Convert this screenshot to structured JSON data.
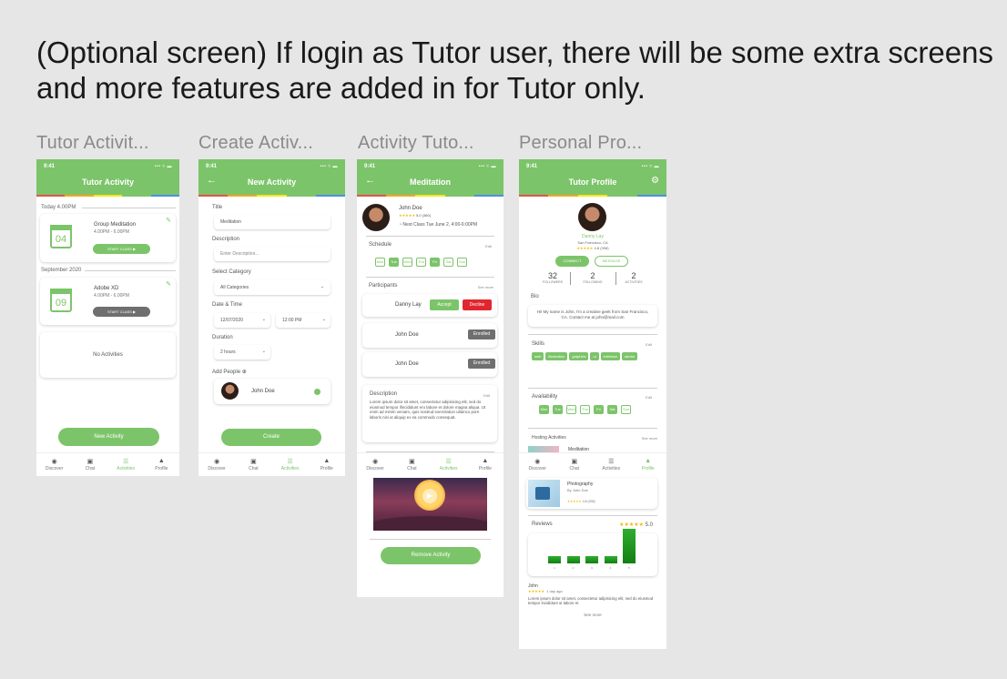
{
  "headline": "(Optional screen) If login as Tutor user, there will be some extra screens and more features are added in for Tutor only.",
  "colors": {
    "accent": "#7cc46a",
    "stripe": [
      "#e2544a",
      "#f5a623",
      "#f8e71c",
      "#7cc46a",
      "#4a90e2"
    ]
  },
  "status": {
    "time": "9:41",
    "signal": "••• ≈ ▬"
  },
  "tabs": [
    {
      "label": "Discover",
      "icon": "compass-icon",
      "glyph": "◉"
    },
    {
      "label": "Chat",
      "icon": "chat-icon",
      "glyph": "▣"
    },
    {
      "label": "Activities",
      "icon": "list-icon",
      "glyph": "☰"
    },
    {
      "label": "Profile",
      "icon": "person-icon",
      "glyph": "▲"
    }
  ],
  "screen1": {
    "frame_title": "Tutor Activit...",
    "title": "Tutor Activity",
    "section1": "Today 4.00PM",
    "card1": {
      "day": "04",
      "name": "Group Meditation",
      "time": "4.00PM - 6.00PM",
      "btn": "START CLASS ▶"
    },
    "section2": "September 2020",
    "card2": {
      "day": "09",
      "name": "Adobe XD",
      "time": "4.00PM - 6.00PM",
      "btn": "START CLASS ▶"
    },
    "empty": "No Activities",
    "new_btn": "New Activity"
  },
  "screen2": {
    "frame_title": "Create Activ...",
    "title": "New Activity",
    "title_label": "Title",
    "title_value": "Meditation",
    "desc_label": "Description",
    "desc_placeholder": "Enter Description...",
    "cat_label": "Select Category",
    "cat_value": "All Categories",
    "dt_label": "Date & Time",
    "date_value": "12/07/2020",
    "time_value": "12:00 PM",
    "dur_label": "Duration",
    "dur_value": "2 hours",
    "people_label": "Add People ⊕",
    "person": "John Doe",
    "create_btn": "Create"
  },
  "screen3": {
    "frame_title": "Activity Tuto...",
    "title": "Meditation",
    "host": "John Doe",
    "stars": "★★★★★",
    "rating": "5.0",
    "reviews": "(360)",
    "next_class": "Next Class Tue June 2, 4:00-6:00PM",
    "schedule_label": "Schedule",
    "edit": "Edit",
    "days": [
      "Mon",
      "Tue",
      "Wed",
      "Thu",
      "Fri",
      "Sat",
      "Sun"
    ],
    "days_on": [
      false,
      true,
      false,
      false,
      true,
      false,
      false
    ],
    "participants_label": "Participants",
    "see_more": "See more",
    "p1": "Danny Lay",
    "accept": "Accept",
    "decline": "Decline",
    "p2": "John Doe",
    "p2_status": "Enrolled",
    "p3": "John Doe",
    "p3_status": "Enrolled",
    "desc_label": "Description",
    "desc": "Lorem ipsum dolor sit amet, consectetur adipisicing elit, sed do eiusmod tempor ifincididunt ero labore et dolore magna aliqua. Ut enim ad minim veniam, quis nostrud exercitation ullamco porri laboris nisi ut aliquip ex ea commodo consequat.",
    "remove_btn": "Remove Activity"
  },
  "screen4": {
    "frame_title": "Personal Pro...",
    "title": "Tutor Profile",
    "name": "Danny Lay",
    "location": "San Francisco, CA",
    "stars": "★★★★★",
    "rating": "4.8",
    "count": "(398)",
    "connect": "CONNECT",
    "message": "MESSAGE",
    "stats": [
      {
        "value": "32",
        "label": "FOLLOWERS"
      },
      {
        "value": "2",
        "label": "FOLLOWING"
      },
      {
        "value": "2",
        "label": "ACTIVITIES"
      }
    ],
    "bio_label": "Bio",
    "bio": "Hi! My name is John, I'm a creative geek from San Francisco, CA. Contact me at john@mail.com",
    "skills_label": "Skills",
    "edit": "Edit",
    "skills": [
      "web",
      "illustration",
      "graphics",
      "ui",
      "interface",
      "adobe"
    ],
    "avail_label": "Availability",
    "days": [
      "Mon",
      "Tue",
      "Wed",
      "Thu",
      "Fri",
      "Sat",
      "Sun"
    ],
    "days_on": [
      true,
      true,
      false,
      false,
      true,
      true,
      false
    ],
    "hosting_label": "Hosting Activities",
    "see_more": "See more",
    "act1": "Meditation",
    "act2": "Photography",
    "act2_by": "By John Doe",
    "act2_stars": "★★★★★",
    "act2_rating": "4.8 (938)",
    "reviews_label": "Reviews",
    "reviews_stars": "★★★★★",
    "reviews_rating": "5.0",
    "bars": [
      {
        "label": "1",
        "value": 2
      },
      {
        "label": "2",
        "value": 2
      },
      {
        "label": "3",
        "value": 2
      },
      {
        "label": "4",
        "value": 2
      },
      {
        "label": "5",
        "value": 10
      }
    ],
    "reviewer": "John",
    "reviewer_stars": "★★★★★",
    "reviewer_when": "1 day ago",
    "review": "Lorem ipsum dolor sit amet, consectetur adipisicing elit, sed do eiusmod tempor incididunt ut labore et",
    "see_more2": "See more"
  }
}
